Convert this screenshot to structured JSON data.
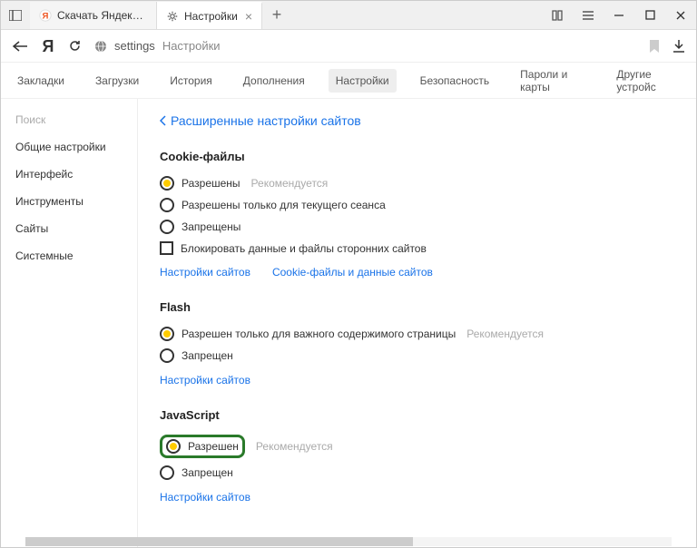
{
  "tabs": [
    {
      "title": "Скачать Яндекс.Браузер д"
    },
    {
      "title": "Настройки"
    }
  ],
  "address": {
    "proto": "settings",
    "page": "Настройки"
  },
  "topnav": {
    "bookmarks": "Закладки",
    "downloads": "Загрузки",
    "history": "История",
    "addons": "Дополнения",
    "settings": "Настройки",
    "security": "Безопасность",
    "passwords": "Пароли и карты",
    "other": "Другие устройс"
  },
  "sidebar": {
    "search": "Поиск",
    "general": "Общие настройки",
    "interface": "Интерфейс",
    "tools": "Инструменты",
    "sites": "Сайты",
    "system": "Системные"
  },
  "main": {
    "back": "Расширенные настройки сайтов",
    "cookies": {
      "title": "Cookie-файлы",
      "opt1": "Разрешены",
      "hint1": "Рекомендуется",
      "opt2": "Разрешены только для текущего сеанса",
      "opt3": "Запрещены",
      "opt4": "Блокировать данные и файлы сторонних сайтов",
      "link1": "Настройки сайтов",
      "link2": "Cookie-файлы и данные сайтов"
    },
    "flash": {
      "title": "Flash",
      "opt1": "Разрешен только для важного содержимого страницы",
      "hint1": "Рекомендуется",
      "opt2": "Запрещен",
      "link1": "Настройки сайтов"
    },
    "js": {
      "title": "JavaScript",
      "opt1": "Разрешен",
      "hint1": "Рекомендуется",
      "opt2": "Запрещен",
      "link1": "Настройки сайтов"
    }
  }
}
